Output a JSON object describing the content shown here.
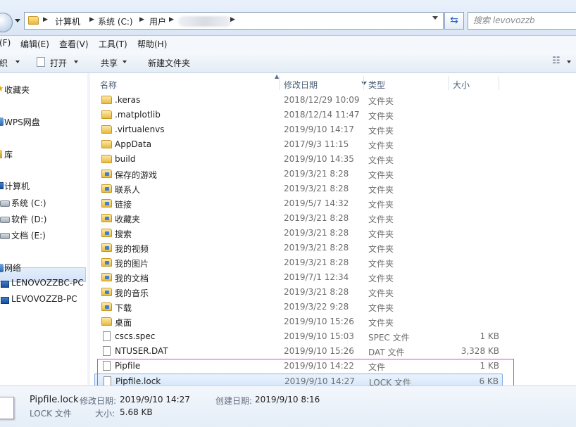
{
  "address": {
    "crumbs": [
      "计算机",
      "系统 (C:)",
      "用户"
    ],
    "search_placeholder": "搜索 levovozzb"
  },
  "menu": [
    "(F)",
    "编辑(E)",
    "查看(V)",
    "工具(T)",
    "帮助(H)"
  ],
  "toolbar": {
    "organize": "织",
    "open": "打开",
    "share": "共享",
    "new_folder": "新建文件夹"
  },
  "nav": {
    "favorites": "收藏夹",
    "wps": "WPS网盘",
    "library": "库",
    "computer": "计算机",
    "drive_c": "系统 (C:)",
    "drive_d": "软件 (D:)",
    "drive_e": "文档 (E:)",
    "network": "网络",
    "pc1": "LENOVOZZBC-PC",
    "pc2": "LEVOVOZZB-PC"
  },
  "columns": {
    "name": "名称",
    "date": "修改日期",
    "type": "类型",
    "size": "大小"
  },
  "files": [
    {
      "name": ".keras",
      "date": "2018/12/29 10:09",
      "type": "文件夹",
      "size": "",
      "icon": "folder"
    },
    {
      "name": ".matplotlib",
      "date": "2018/12/14 11:47",
      "type": "文件夹",
      "size": "",
      "icon": "folder"
    },
    {
      "name": ".virtualenvs",
      "date": "2019/9/10 14:17",
      "type": "文件夹",
      "size": "",
      "icon": "folder"
    },
    {
      "name": "AppData",
      "date": "2017/9/3 11:15",
      "type": "文件夹",
      "size": "",
      "icon": "folder"
    },
    {
      "name": "build",
      "date": "2019/9/10 14:35",
      "type": "文件夹",
      "size": "",
      "icon": "folder"
    },
    {
      "name": "保存的游戏",
      "date": "2019/3/21 8:28",
      "type": "文件夹",
      "size": "",
      "icon": "folder-special"
    },
    {
      "name": "联系人",
      "date": "2019/3/21 8:28",
      "type": "文件夹",
      "size": "",
      "icon": "folder-special"
    },
    {
      "name": "链接",
      "date": "2019/5/7 14:32",
      "type": "文件夹",
      "size": "",
      "icon": "folder-special"
    },
    {
      "name": "收藏夹",
      "date": "2019/3/21 8:28",
      "type": "文件夹",
      "size": "",
      "icon": "folder-special"
    },
    {
      "name": "搜索",
      "date": "2019/3/21 8:28",
      "type": "文件夹",
      "size": "",
      "icon": "folder-special"
    },
    {
      "name": "我的视频",
      "date": "2019/3/21 8:28",
      "type": "文件夹",
      "size": "",
      "icon": "folder-special"
    },
    {
      "name": "我的图片",
      "date": "2019/3/21 8:28",
      "type": "文件夹",
      "size": "",
      "icon": "folder-special"
    },
    {
      "name": "我的文档",
      "date": "2019/7/1 12:34",
      "type": "文件夹",
      "size": "",
      "icon": "folder-special"
    },
    {
      "name": "我的音乐",
      "date": "2019/3/21 8:28",
      "type": "文件夹",
      "size": "",
      "icon": "folder-special"
    },
    {
      "name": "下载",
      "date": "2019/3/22 9:28",
      "type": "文件夹",
      "size": "",
      "icon": "folder-special"
    },
    {
      "name": "桌面",
      "date": "2019/9/10 15:26",
      "type": "文件夹",
      "size": "",
      "icon": "folder"
    },
    {
      "name": "cscs.spec",
      "date": "2019/9/10 15:03",
      "type": "SPEC 文件",
      "size": "1 KB",
      "icon": "doc"
    },
    {
      "name": "NTUSER.DAT",
      "date": "2019/9/10 15:26",
      "type": "DAT 文件",
      "size": "3,328 KB",
      "icon": "doc"
    },
    {
      "name": "Pipfile",
      "date": "2019/9/10 14:22",
      "type": "文件",
      "size": "1 KB",
      "icon": "doc"
    },
    {
      "name": "Pipfile.lock",
      "date": "2019/9/10 14:27",
      "type": "LOCK 文件",
      "size": "6 KB",
      "icon": "doc",
      "selected": true
    }
  ],
  "details": {
    "filename": "Pipfile.lock",
    "modified_label": "修改日期:",
    "modified": "2019/9/10 14:27",
    "created_label": "创建日期:",
    "created": "2019/9/10 8:16",
    "type": "LOCK 文件",
    "size_label": "大小:",
    "size": "5.68 KB"
  }
}
